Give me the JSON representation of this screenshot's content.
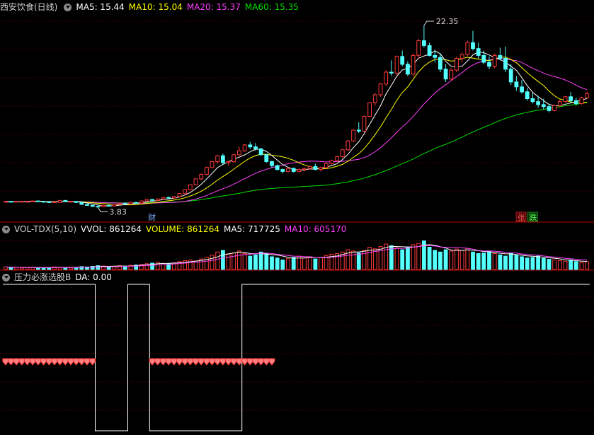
{
  "colors": {
    "up": "#ff3a3a",
    "down": "#54ffff",
    "ma5": "#ffffff",
    "ma10": "#ffff00",
    "ma20": "#ff40ff",
    "ma60": "#00e000",
    "grid": "#7a0000",
    "label_up": "#ff6060",
    "label_down": "#60ff60"
  },
  "price_panel": {
    "title": "西安饮食(日线)",
    "ma5": "MA5: 15.44",
    "ma10": "MA10: 15.04",
    "ma20": "MA20: 15.37",
    "ma60": "MA60: 15.35",
    "high_label": "22.35",
    "low_label": "3.83",
    "event_cai": "财",
    "event_zhang": "张",
    "event_die": "跌"
  },
  "volume_panel": {
    "title": "VOL-TDX(5,10)",
    "vvol": "VVOL: 861264",
    "volume": "VOLUME: 861264",
    "ma5": "MA5: 717725",
    "ma10": "MA10: 605170"
  },
  "indicator_panel": {
    "title": "压力必涨选股B",
    "da": "DA: 0.00"
  },
  "chart_data": {
    "type": "candlestick",
    "ylim": [
      3.5,
      23.5
    ],
    "candles": [
      [
        4.45,
        4.5,
        4.4,
        4.45
      ],
      [
        4.45,
        4.5,
        4.35,
        4.4
      ],
      [
        4.4,
        4.5,
        4.35,
        4.45
      ],
      [
        4.45,
        4.5,
        4.4,
        4.45
      ],
      [
        4.45,
        4.5,
        4.4,
        4.45
      ],
      [
        4.45,
        4.55,
        4.4,
        4.5
      ],
      [
        4.5,
        4.55,
        4.4,
        4.45
      ],
      [
        4.45,
        4.5,
        4.35,
        4.4
      ],
      [
        4.4,
        4.45,
        4.3,
        4.35
      ],
      [
        4.35,
        4.45,
        4.3,
        4.4
      ],
      [
        4.35,
        4.6,
        4.3,
        4.55
      ],
      [
        4.55,
        4.6,
        4.4,
        4.45
      ],
      [
        4.45,
        4.5,
        4.4,
        4.45
      ],
      [
        4.45,
        4.5,
        4.3,
        4.35
      ],
      [
        4.35,
        4.4,
        4.1,
        4.15
      ],
      [
        4.15,
        4.2,
        4.0,
        4.05
      ],
      [
        4.05,
        4.1,
        3.9,
        3.95
      ],
      [
        3.95,
        4.05,
        3.83,
        3.9
      ],
      [
        3.9,
        4.1,
        3.88,
        4.05
      ],
      [
        4.05,
        4.15,
        3.95,
        4.0
      ],
      [
        4.0,
        4.2,
        3.95,
        4.15
      ],
      [
        4.15,
        4.3,
        4.1,
        4.25
      ],
      [
        4.25,
        4.35,
        4.15,
        4.2
      ],
      [
        4.2,
        4.4,
        4.15,
        4.35
      ],
      [
        4.35,
        4.4,
        4.25,
        4.3
      ],
      [
        4.3,
        4.55,
        4.25,
        4.5
      ],
      [
        4.5,
        4.7,
        4.45,
        4.65
      ],
      [
        4.65,
        4.7,
        4.5,
        4.55
      ],
      [
        4.55,
        4.75,
        4.5,
        4.7
      ],
      [
        4.7,
        4.9,
        4.65,
        4.85
      ],
      [
        4.85,
        4.95,
        4.75,
        4.8
      ],
      [
        4.8,
        5.0,
        4.75,
        4.95
      ],
      [
        4.95,
        5.3,
        4.9,
        5.25
      ],
      [
        5.25,
        5.7,
        5.2,
        5.65
      ],
      [
        5.65,
        6.2,
        5.6,
        6.15
      ],
      [
        6.15,
        6.8,
        6.1,
        6.75
      ],
      [
        6.75,
        7.3,
        6.6,
        7.2
      ],
      [
        7.2,
        8.0,
        7.1,
        7.9
      ],
      [
        7.9,
        8.6,
        7.8,
        8.5
      ],
      [
        8.5,
        9.2,
        8.3,
        9.1
      ],
      [
        9.1,
        9.3,
        8.2,
        8.4
      ],
      [
        8.4,
        8.6,
        8.1,
        8.5
      ],
      [
        8.5,
        9.3,
        8.4,
        9.2
      ],
      [
        9.2,
        10.0,
        9.1,
        9.6
      ],
      [
        9.6,
        10.3,
        9.5,
        10.2
      ],
      [
        10.2,
        10.5,
        9.8,
        10.0
      ],
      [
        10.0,
        10.4,
        9.6,
        9.8
      ],
      [
        9.8,
        9.9,
        9.1,
        9.2
      ],
      [
        9.2,
        9.3,
        8.4,
        8.5
      ],
      [
        8.5,
        8.6,
        7.9,
        8.1
      ],
      [
        8.1,
        8.2,
        7.6,
        7.7
      ],
      [
        7.7,
        7.8,
        7.3,
        7.5
      ],
      [
        7.5,
        7.9,
        7.4,
        7.8
      ],
      [
        7.8,
        7.9,
        7.4,
        7.5
      ],
      [
        7.5,
        7.8,
        7.4,
        7.7
      ],
      [
        7.7,
        7.9,
        7.5,
        7.8
      ],
      [
        7.8,
        8.1,
        7.7,
        8.0
      ],
      [
        8.0,
        8.3,
        7.6,
        7.7
      ],
      [
        7.7,
        8.0,
        7.5,
        7.9
      ],
      [
        7.9,
        8.4,
        7.8,
        8.3
      ],
      [
        8.3,
        8.7,
        8.2,
        8.6
      ],
      [
        8.6,
        9.1,
        8.5,
        9.0
      ],
      [
        9.0,
        9.8,
        8.9,
        9.7
      ],
      [
        9.7,
        10.7,
        9.6,
        10.6
      ],
      [
        10.6,
        11.8,
        10.5,
        11.7
      ],
      [
        11.7,
        12.5,
        11.4,
        11.6
      ],
      [
        11.6,
        13.2,
        11.5,
        13.1
      ],
      [
        13.1,
        14.6,
        13.0,
        14.5
      ],
      [
        14.5,
        15.5,
        14.2,
        15.3
      ],
      [
        15.3,
        16.5,
        15.1,
        16.4
      ],
      [
        16.4,
        17.8,
        16.2,
        17.6
      ],
      [
        17.6,
        18.8,
        17.2,
        17.5
      ],
      [
        17.5,
        19.3,
        17.3,
        19.2
      ],
      [
        19.2,
        19.8,
        18.2,
        18.4
      ],
      [
        18.4,
        18.7,
        17.2,
        17.4
      ],
      [
        17.4,
        19.5,
        17.2,
        19.3
      ],
      [
        19.3,
        21.0,
        19.0,
        20.8
      ],
      [
        20.8,
        22.35,
        20.1,
        20.3
      ],
      [
        20.3,
        20.6,
        19.2,
        19.3
      ],
      [
        19.3,
        19.9,
        18.6,
        19.1
      ],
      [
        19.1,
        19.5,
        17.6,
        17.9
      ],
      [
        17.9,
        18.4,
        16.6,
        16.9
      ],
      [
        16.9,
        18.0,
        16.7,
        17.8
      ],
      [
        17.8,
        19.2,
        17.6,
        19.0
      ],
      [
        19.0,
        19.6,
        18.6,
        19.4
      ],
      [
        19.4,
        20.8,
        19.2,
        20.6
      ],
      [
        20.6,
        21.8,
        19.8,
        20.0
      ],
      [
        20.0,
        20.6,
        18.9,
        19.3
      ],
      [
        19.3,
        19.8,
        18.4,
        18.6
      ],
      [
        18.6,
        19.2,
        17.9,
        18.2
      ],
      [
        18.2,
        19.5,
        18.0,
        19.3
      ],
      [
        19.3,
        20.1,
        18.8,
        19.0
      ],
      [
        19.0,
        20.2,
        17.6,
        17.9
      ],
      [
        17.9,
        18.4,
        16.3,
        16.6
      ],
      [
        16.6,
        17.2,
        15.7,
        16.1
      ],
      [
        16.1,
        16.8,
        15.4,
        15.6
      ],
      [
        15.6,
        16.0,
        14.7,
        14.9
      ],
      [
        14.9,
        15.5,
        14.4,
        14.6
      ],
      [
        14.6,
        15.2,
        14.0,
        14.3
      ],
      [
        14.3,
        14.9,
        13.8,
        14.1
      ],
      [
        14.1,
        14.4,
        13.5,
        13.7
      ],
      [
        13.7,
        14.3,
        13.6,
        14.2
      ],
      [
        14.2,
        14.8,
        14.0,
        14.6
      ],
      [
        14.6,
        15.2,
        14.5,
        15.1
      ],
      [
        15.1,
        15.6,
        14.5,
        14.7
      ],
      [
        14.7,
        15.0,
        14.2,
        14.4
      ],
      [
        14.4,
        15.1,
        14.3,
        15.0
      ],
      [
        15.0,
        15.6,
        14.9,
        15.4
      ]
    ],
    "volumes": [
      0.08,
      0.06,
      0.07,
      0.05,
      0.06,
      0.07,
      0.06,
      0.05,
      0.06,
      0.08,
      0.07,
      0.06,
      0.05,
      0.07,
      0.09,
      0.08,
      0.1,
      0.12,
      0.11,
      0.09,
      0.1,
      0.12,
      0.11,
      0.13,
      0.14,
      0.16,
      0.18,
      0.2,
      0.22,
      0.19,
      0.18,
      0.21,
      0.25,
      0.28,
      0.3,
      0.27,
      0.33,
      0.38,
      0.45,
      0.55,
      0.6,
      0.48,
      0.52,
      0.58,
      0.5,
      0.42,
      0.46,
      0.55,
      0.5,
      0.4,
      0.36,
      0.3,
      0.34,
      0.38,
      0.42,
      0.36,
      0.4,
      0.33,
      0.37,
      0.44,
      0.48,
      0.5,
      0.55,
      0.62,
      0.58,
      0.52,
      0.6,
      0.7,
      0.65,
      0.72,
      0.8,
      0.75,
      0.68,
      0.62,
      0.7,
      0.78,
      0.82,
      0.9,
      0.7,
      0.6,
      0.55,
      0.62,
      0.58,
      0.64,
      0.6,
      0.66,
      0.55,
      0.5,
      0.52,
      0.58,
      0.5,
      0.46,
      0.42,
      0.5,
      0.45,
      0.4,
      0.36,
      0.38,
      0.42,
      0.35,
      0.32,
      0.3,
      0.28,
      0.26,
      0.3,
      0.25,
      0.22,
      0.24
    ],
    "indicator_states": [
      0,
      0,
      0,
      0,
      0,
      0,
      0,
      0,
      0,
      0,
      0,
      0,
      0,
      0,
      0,
      0,
      0,
      1,
      1,
      1,
      1,
      1,
      1,
      0,
      0,
      0,
      0,
      1,
      1,
      1,
      1,
      1,
      1,
      1,
      1,
      1,
      1,
      1,
      1,
      1,
      1,
      1,
      1,
      1,
      0,
      0,
      0,
      0,
      0,
      0,
      0,
      0,
      0,
      0,
      0,
      0,
      0,
      0,
      0,
      0,
      0,
      0,
      0,
      0,
      0,
      0,
      0,
      0,
      0,
      0,
      0,
      0,
      0,
      0,
      0,
      0,
      0,
      0,
      0,
      0,
      0,
      0,
      0,
      0,
      0,
      0,
      0,
      0,
      0,
      0,
      0,
      0,
      0,
      0,
      0,
      0,
      0,
      0,
      0,
      0,
      0,
      0,
      0,
      0,
      0,
      0,
      0,
      0
    ],
    "indicator_markers": [
      0,
      1,
      2,
      3,
      4,
      5,
      6,
      7,
      8,
      9,
      10,
      11,
      12,
      13,
      14,
      15,
      16,
      27,
      28,
      29,
      30,
      31,
      32,
      33,
      34,
      35,
      36,
      37,
      38,
      39,
      40,
      41,
      42,
      43,
      44,
      45,
      46,
      47,
      48,
      49
    ]
  }
}
